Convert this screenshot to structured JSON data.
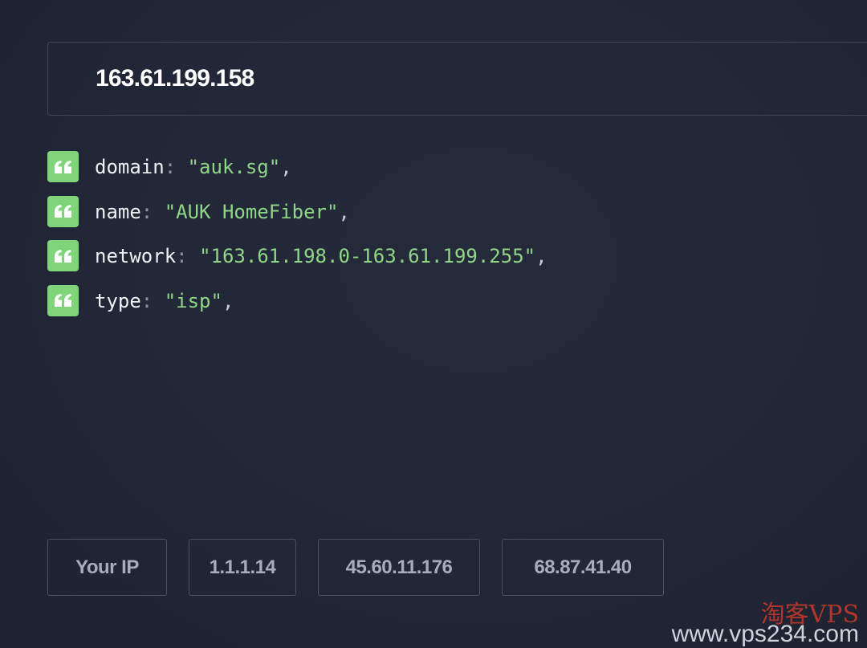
{
  "search": {
    "value": "163.61.199.158"
  },
  "result": {
    "rows": [
      {
        "key": "domain",
        "value": "\"auk.sg\"",
        "icon": "quote-icon"
      },
      {
        "key": "name",
        "value": "\"AUK HomeFiber\"",
        "icon": "quote-icon"
      },
      {
        "key": "network",
        "value": "\"163.61.198.0-163.61.199.255\"",
        "icon": "quote-icon"
      },
      {
        "key": "type",
        "value": "\"isp\"",
        "icon": "quote-icon"
      }
    ],
    "colon": ":",
    "comma": ","
  },
  "ip_buttons": [
    "Your IP",
    "1.1.1.14",
    "45.60.11.176",
    "68.87.41.40"
  ],
  "watermark": {
    "cn": "淘客VPS",
    "url": "www.vps234.com"
  },
  "colors": {
    "background": "#232837",
    "accent_green": "#80d47a",
    "string_green": "#8fd687"
  }
}
